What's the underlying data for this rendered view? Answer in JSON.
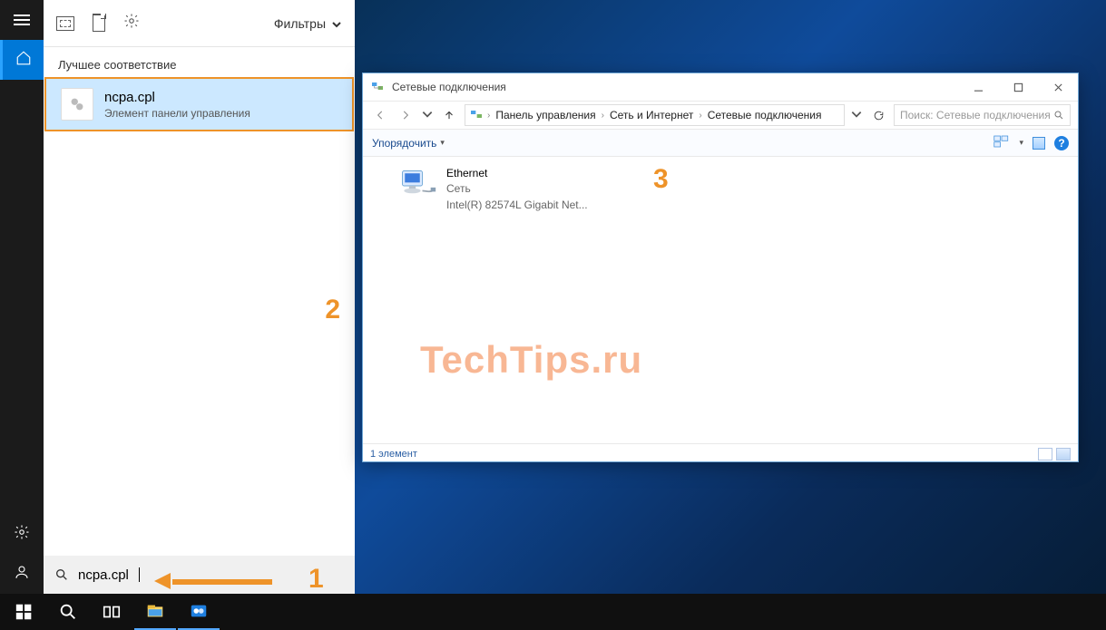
{
  "sidebar": {
    "items": [
      "menu",
      "home",
      "settings",
      "user"
    ]
  },
  "search_panel": {
    "filters_label": "Фильтры",
    "best_match_label": "Лучшее соответствие",
    "result": {
      "title": "ncpa.cpl",
      "subtitle": "Элемент панели управления"
    },
    "query": "ncpa.cpl"
  },
  "explorer": {
    "title": "Сетевые подключения",
    "breadcrumbs": [
      "Панель управления",
      "Сеть и Интернет",
      "Сетевые подключения"
    ],
    "search_placeholder": "Поиск: Сетевые подключения",
    "organize_label": "Упорядочить",
    "item": {
      "name": "Ethernet",
      "line2": "Сеть",
      "line3": "Intel(R) 82574L Gigabit Net..."
    },
    "status_text": "1 элемент",
    "help_char": "?"
  },
  "annotations": {
    "one": "1",
    "two": "2",
    "three": "3"
  },
  "watermark": "TechTips.ru"
}
